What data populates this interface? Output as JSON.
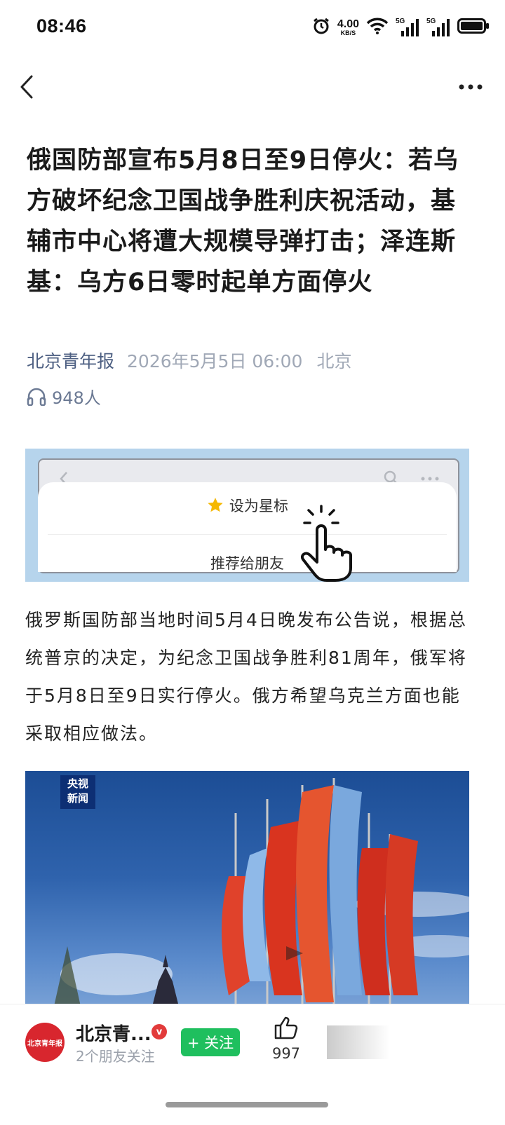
{
  "status_bar": {
    "time": "08:46",
    "net_speed_value": "4.00",
    "net_speed_unit": "KB/S",
    "signal1_label": "5G",
    "signal2_label": "5G"
  },
  "article": {
    "title": "俄国防部宣布5月8日至9日停火：若乌方破坏纪念卫国战争胜利庆祝活动，基辅市中心将遭大规模导弹打击；泽连斯基：乌方6日零时起单方面停火",
    "source": "北京青年报",
    "date": "2026年5月5日 06:00",
    "location": "北京",
    "listeners": "948人",
    "body": "俄罗斯国防部当地时间5月4日晚发布公告说，根据总统普京的决定，为纪念卫国战争胜利81周年，俄军将于5月8日至9日实行停火。俄方希望乌克兰方面也能采取相应做法。"
  },
  "promo_banner": {
    "star_label": "设为星标",
    "recommend_label": "推荐给朋友"
  },
  "photo": {
    "watermark_line1": "央视",
    "watermark_line2": "新闻"
  },
  "bottom_bar": {
    "account_name": "北京青...",
    "friends_following": "2个朋友关注",
    "follow_label": "+ 关注",
    "like_count": "997",
    "avatar_text": "北京青年报"
  },
  "colors": {
    "follow_green": "#1fbf5e",
    "source_blue": "#4d5f82",
    "banner_blue": "#b6d4ec"
  }
}
